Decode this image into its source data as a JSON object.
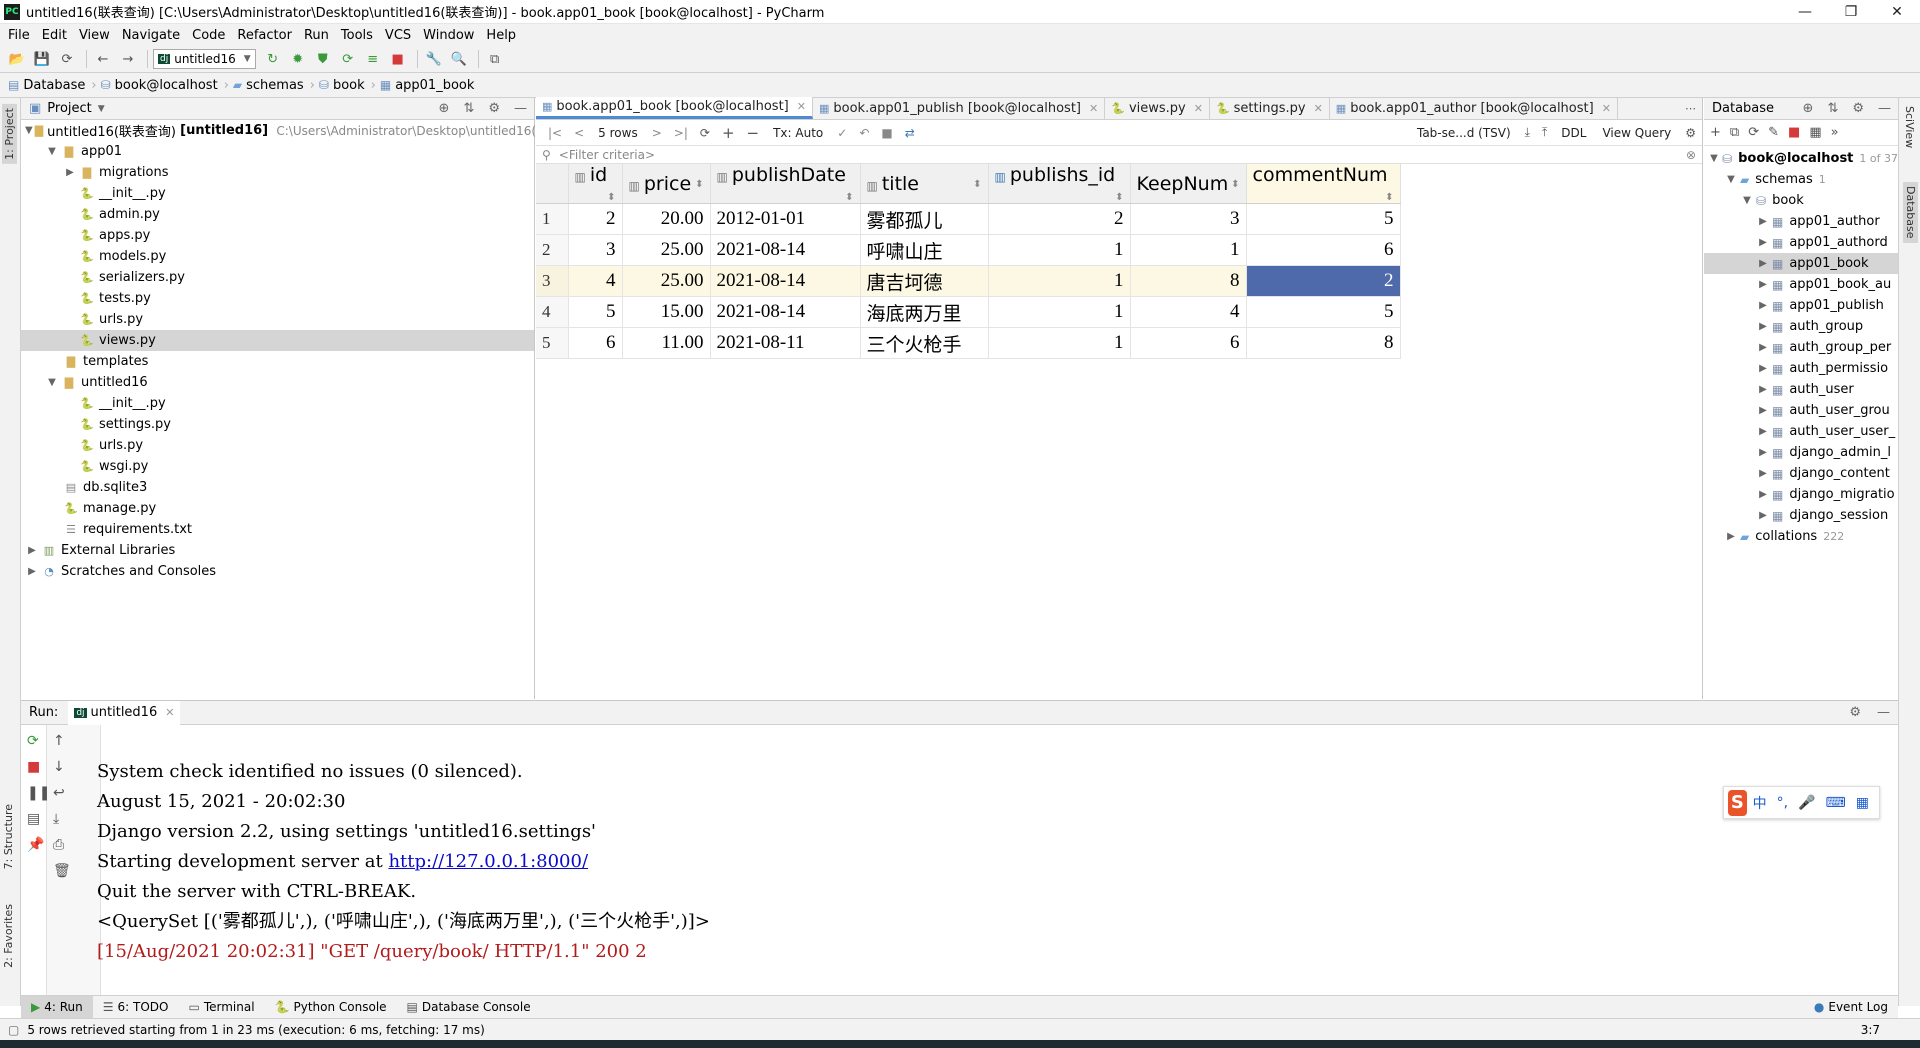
{
  "window": {
    "title": "untitled16(联表查询) [C:\\Users\\Administrator\\Desktop\\untitled16(联表查询)] - book.app01_book [book@localhost] - PyCharm",
    "app_icon": "PC"
  },
  "menu": [
    "File",
    "Edit",
    "View",
    "Navigate",
    "Code",
    "Refactor",
    "Run",
    "Tools",
    "VCS",
    "Window",
    "Help"
  ],
  "toolbar": {
    "run_config": "untitled16"
  },
  "breadcrumb": [
    "Database",
    "book@localhost",
    "schemas",
    "book",
    "app01_book"
  ],
  "left_tabs": {
    "project": "1: Project",
    "structure": "7: Structure",
    "favorites": "2: Favorites"
  },
  "right_tabs": {
    "sciview": "SciView",
    "database": "Database"
  },
  "project_panel": {
    "title": "Project",
    "root": {
      "name": "untitled16(联表查询)",
      "bold": "[untitled16]",
      "path": "C:\\Users\\Administrator\\Desktop\\untitled16(联表"
    },
    "items": [
      "app01",
      "migrations",
      "__init__.py",
      "admin.py",
      "apps.py",
      "models.py",
      "serializers.py",
      "tests.py",
      "urls.py",
      "views.py",
      "templates",
      "untitled16",
      "__init__.py",
      "settings.py",
      "urls.py",
      "wsgi.py",
      "db.sqlite3",
      "manage.py",
      "requirements.txt",
      "External Libraries",
      "Scratches and Consoles"
    ]
  },
  "editor_tabs": [
    "book.app01_book [book@localhost]",
    "book.app01_publish [book@localhost]",
    "views.py",
    "settings.py",
    "book.app01_author [book@localhost]"
  ],
  "grid_toolbar": {
    "rows": "5 rows",
    "tx": "Tx: Auto",
    "format": "Tab-se...d (TSV)",
    "ddl": "DDL",
    "view_query": "View Query"
  },
  "filter_placeholder": "<Filter criteria>",
  "table": {
    "columns": [
      "id",
      "price",
      "publishDate",
      "title",
      "publishs_id",
      "KeepNum",
      "commentNum"
    ],
    "rows": [
      [
        "1",
        "2",
        "20.00",
        "2012-01-01",
        "雾都孤儿",
        "2",
        "3",
        "5"
      ],
      [
        "2",
        "3",
        "25.00",
        "2021-08-14",
        "呼啸山庄",
        "1",
        "1",
        "6"
      ],
      [
        "3",
        "4",
        "25.00",
        "2021-08-14",
        "唐吉坷德",
        "1",
        "8",
        "2"
      ],
      [
        "4",
        "5",
        "15.00",
        "2021-08-14",
        "海底两万里",
        "1",
        "4",
        "5"
      ],
      [
        "5",
        "6",
        "11.00",
        "2021-08-11",
        "三个火枪手",
        "1",
        "6",
        "8"
      ]
    ]
  },
  "db_panel": {
    "title": "Database",
    "conn": "book@localhost",
    "conn_count": "1 of 37",
    "schemas": "schemas",
    "schemas_count": "1",
    "schema": "book",
    "tables": [
      "app01_author",
      "app01_authord",
      "app01_book",
      "app01_book_au",
      "app01_publish",
      "auth_group",
      "auth_group_per",
      "auth_permissio",
      "auth_user",
      "auth_user_grou",
      "auth_user_user_",
      "django_admin_l",
      "django_content",
      "django_migratio",
      "django_session"
    ],
    "collations": "collations",
    "collations_count": "222"
  },
  "run_panel": {
    "label": "Run:",
    "tab": "untitled16",
    "lines": [
      "System check identified no issues (0 silenced).",
      "August 15, 2021 - 20:02:30",
      "Django version 2.2, using settings 'untitled16.settings'",
      "Starting development server at ",
      "Quit the server with CTRL-BREAK.",
      "<QuerySet [('雾都孤儿',), ('呼啸山庄',), ('海底两万里',), ('三个火枪手',)]>",
      "[15/Aug/2021 20:02:31] \"GET /query/book/ HTTP/1.1\" 200 2"
    ],
    "link": "http://127.0.0.1:8000/"
  },
  "ime": {
    "lang": "中",
    "punct": "°,"
  },
  "tool_tabs": [
    "4: Run",
    "6: TODO",
    "Terminal",
    "Python Console",
    "Database Console"
  ],
  "event_log": "Event Log",
  "status": {
    "message": "5 rows retrieved starting from 1 in 23 ms (execution: 6 ms, fetching: 17 ms)",
    "position": "3:7"
  },
  "colors": {
    "selected_cell": "#4e6aaa",
    "current_row": "#fdf8e4",
    "error_text": "#b31b1b",
    "active_tab_underline": "#4d8ad6"
  }
}
